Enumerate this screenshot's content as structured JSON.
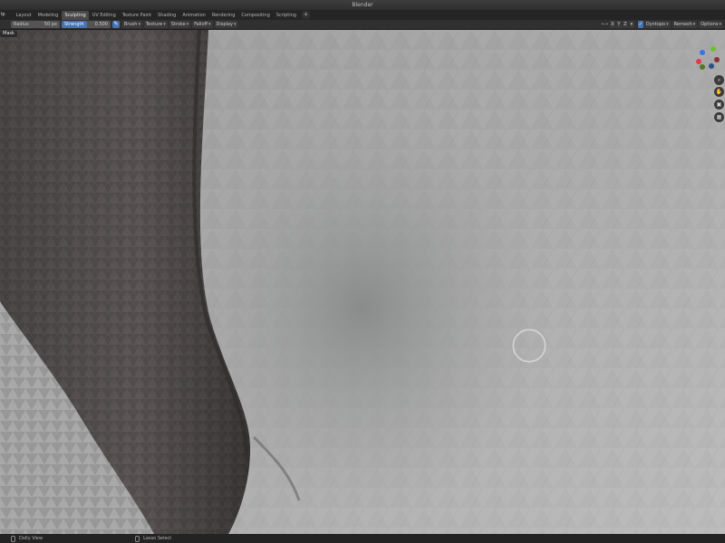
{
  "window": {
    "title": "Blender"
  },
  "menu": {
    "stub_label": "lp"
  },
  "workspaces": {
    "tabs": [
      "Layout",
      "Modeling",
      "Sculpting",
      "UV Editing",
      "Texture Paint",
      "Shading",
      "Animation",
      "Rendering",
      "Compositing",
      "Scripting"
    ],
    "active": "Sculpting",
    "add_label": "+"
  },
  "tool_header": {
    "radius_label": "Radius",
    "radius_value": "50 px",
    "strength_label": "Strength",
    "strength_value": "0.500",
    "brush_label": "Brush",
    "texture_label": "Texture",
    "stroke_label": "Stroke",
    "falloff_label": "Falloff",
    "display_label": "Display",
    "axis_x": "X",
    "axis_y": "Y",
    "axis_z": "Z",
    "dyntopo_label": "Dyntopo",
    "remesh_label": "Remesh",
    "options_label": "Options"
  },
  "viewport": {
    "mask_label": "Mask",
    "gizmo_colors": {
      "x": "#e23a4a",
      "y": "#6fbf2a",
      "z": "#3a76e2"
    },
    "nav_icons": [
      "zoom-icon",
      "hand-pan-icon",
      "camera-icon",
      "grid-icon"
    ]
  },
  "status": {
    "left_label": "Dolly View",
    "right_label": "Lasso Select"
  }
}
